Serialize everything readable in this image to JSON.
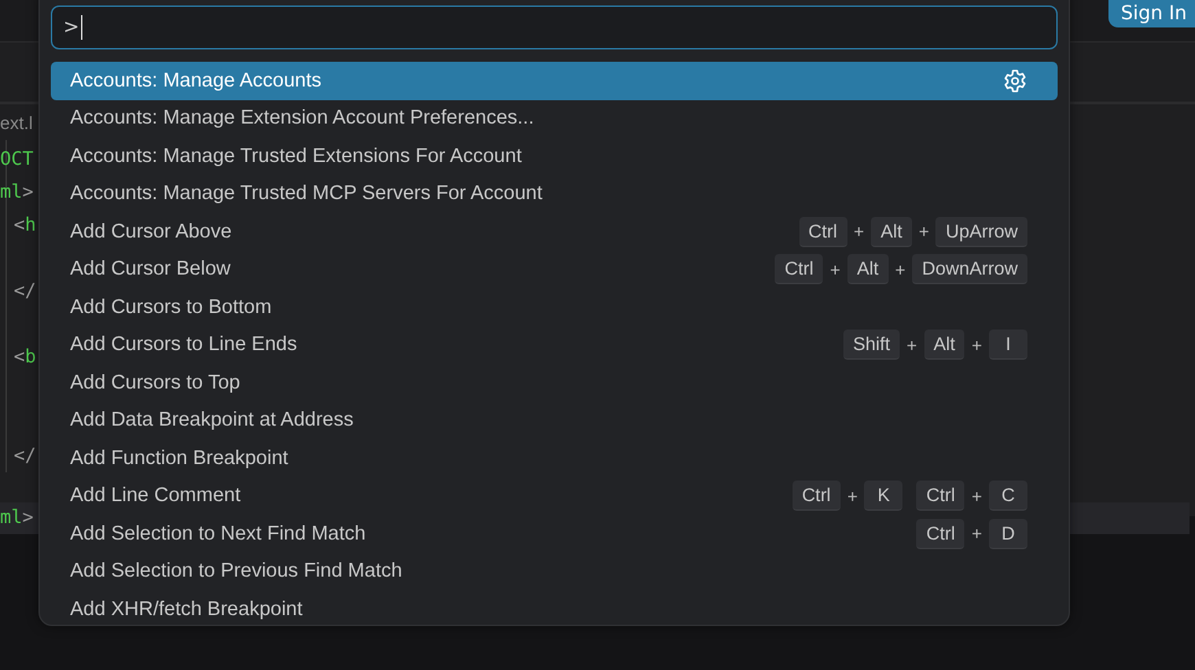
{
  "title_bar": {
    "sign_in_button": "Sign In"
  },
  "editor": {
    "tab_label": "ext.l",
    "lines": [
      [
        {
          "kind": "tag",
          "text": "OCT"
        }
      ],
      [
        {
          "kind": "tag",
          "text": "ml"
        },
        {
          "kind": "punct",
          "text": ">"
        }
      ],
      [
        {
          "kind": "punct",
          "text": "<"
        },
        {
          "kind": "tag",
          "text": "h"
        }
      ],
      [
        {
          "kind": "punct",
          "text": "</"
        }
      ],
      [
        {
          "kind": "punct",
          "text": "<"
        },
        {
          "kind": "tag",
          "text": "b"
        }
      ],
      [
        {
          "kind": "punct",
          "text": "</"
        }
      ]
    ],
    "breadcrumb": [
      {
        "kind": "tag",
        "text": "ml"
      },
      {
        "kind": "punct",
        "text": ">"
      }
    ]
  },
  "command_palette": {
    "input": {
      "value": ">"
    },
    "items": [
      {
        "label": "Accounts: Manage Accounts",
        "selected": true
      },
      {
        "label": "Accounts: Manage Extension Account Preferences...",
        "selected": false
      },
      {
        "label": "Accounts: Manage Trusted Extensions For Account",
        "selected": false
      },
      {
        "label": "Accounts: Manage Trusted MCP Servers For Account",
        "selected": false
      },
      {
        "label": "Add Cursor Above",
        "selected": false,
        "chords": [
          [
            "Ctrl",
            "+",
            "Alt",
            "+",
            "UpArrow"
          ]
        ]
      },
      {
        "label": "Add Cursor Below",
        "selected": false,
        "chords": [
          [
            "Ctrl",
            "+",
            "Alt",
            "+",
            "DownArrow"
          ]
        ]
      },
      {
        "label": "Add Cursors to Bottom",
        "selected": false
      },
      {
        "label": "Add Cursors to Line Ends",
        "selected": false,
        "chords": [
          [
            "Shift",
            "+",
            "Alt",
            "+",
            "I"
          ]
        ]
      },
      {
        "label": "Add Cursors to Top",
        "selected": false
      },
      {
        "label": "Add Data Breakpoint at Address",
        "selected": false
      },
      {
        "label": "Add Function Breakpoint",
        "selected": false
      },
      {
        "label": "Add Line Comment",
        "selected": false,
        "chords": [
          [
            "Ctrl",
            "+",
            "K"
          ],
          [
            "Ctrl",
            "+",
            "C"
          ]
        ]
      },
      {
        "label": "Add Selection to Next Find Match",
        "selected": false,
        "chords": [
          [
            "Ctrl",
            "+",
            "D"
          ]
        ]
      },
      {
        "label": "Add Selection to Previous Find Match",
        "selected": false
      },
      {
        "label": "Add XHR/fetch Breakpoint",
        "selected": false
      }
    ]
  }
}
